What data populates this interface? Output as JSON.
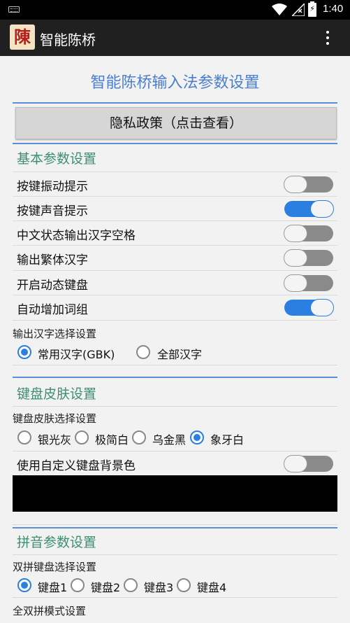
{
  "status": {
    "time": "1:40"
  },
  "appbar": {
    "logo_char": "陳",
    "title": "智能陈桥"
  },
  "page": {
    "title": "智能陈桥输入法参数设置",
    "privacy_button": "隐私政策（点击查看）"
  },
  "basic": {
    "header": "基本参数设置",
    "toggles": [
      {
        "label": "按键振动提示",
        "on": false
      },
      {
        "label": "按键声音提示",
        "on": true
      },
      {
        "label": "中文状态输出汉字空格",
        "on": false
      },
      {
        "label": "输出繁体汉字",
        "on": false
      },
      {
        "label": "开启动态键盘",
        "on": false
      },
      {
        "label": "自动增加词组",
        "on": true
      }
    ],
    "charset_label": "输出汉字选择设置",
    "charset_options": [
      "常用汉字(GBK)",
      "全部汉字"
    ],
    "charset_selected": "常用汉字(GBK)"
  },
  "skin": {
    "header": "键盘皮肤设置",
    "skin_label": "键盘皮肤选择设置",
    "skin_options": [
      "银光灰",
      "极简白",
      "乌金黑",
      "象牙白"
    ],
    "skin_selected": "象牙白",
    "custom_bg_label": "使用自定义键盘背景色",
    "custom_bg_on": false,
    "custom_bg_color": "#000000"
  },
  "pinyin": {
    "header": "拼音参数设置",
    "shuangpin_label": "双拼键盘选择设置",
    "keyboard_options": [
      "键盘1",
      "键盘2",
      "键盘3",
      "键盘4"
    ],
    "keyboard_selected": "键盘1",
    "full_mode_label": "全双拼模式设置"
  },
  "colors": {
    "accent": "#2a7fe0",
    "title": "#4a7fcf",
    "section": "#3d8f73"
  }
}
